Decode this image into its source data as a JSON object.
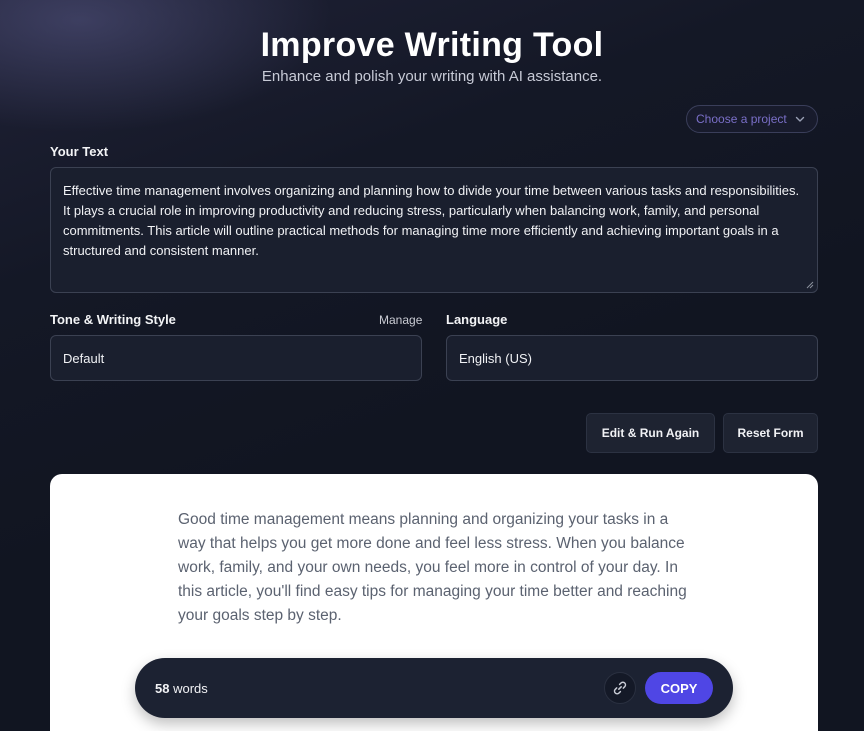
{
  "header": {
    "title": "Improve Writing Tool",
    "subtitle": "Enhance and polish your writing with AI assistance."
  },
  "project_select": {
    "placeholder": "Choose a project"
  },
  "input": {
    "label": "Your Text",
    "value": "Effective time management involves organizing and planning how to divide your time between various tasks and responsibilities. It plays a crucial role in improving productivity and reducing stress, particularly when balancing work, family, and personal commitments. This article will outline practical methods for managing time more efficiently and achieving important goals in a structured and consistent manner."
  },
  "tone": {
    "label": "Tone & Writing Style",
    "manage_label": "Manage",
    "value": "Default"
  },
  "language": {
    "label": "Language",
    "value": "English (US)"
  },
  "actions": {
    "edit_run_label": "Edit & Run Again",
    "reset_label": "Reset Form"
  },
  "result": {
    "text": "Good time management means planning and organizing your tasks in a way that helps you get more done and feel less stress. When you balance work, family, and your own needs, you feel more in control of your day. In this article, you'll find easy tips for managing your time better and reaching your goals step by step.",
    "word_count": "58",
    "word_unit": "words",
    "copy_label": "COPY"
  },
  "icons": {
    "chevron": "chevron-down-icon",
    "link": "link-icon"
  },
  "colors": {
    "accent": "#4f46e5",
    "background": "#111521",
    "field_bg": "#1a1f2e"
  }
}
